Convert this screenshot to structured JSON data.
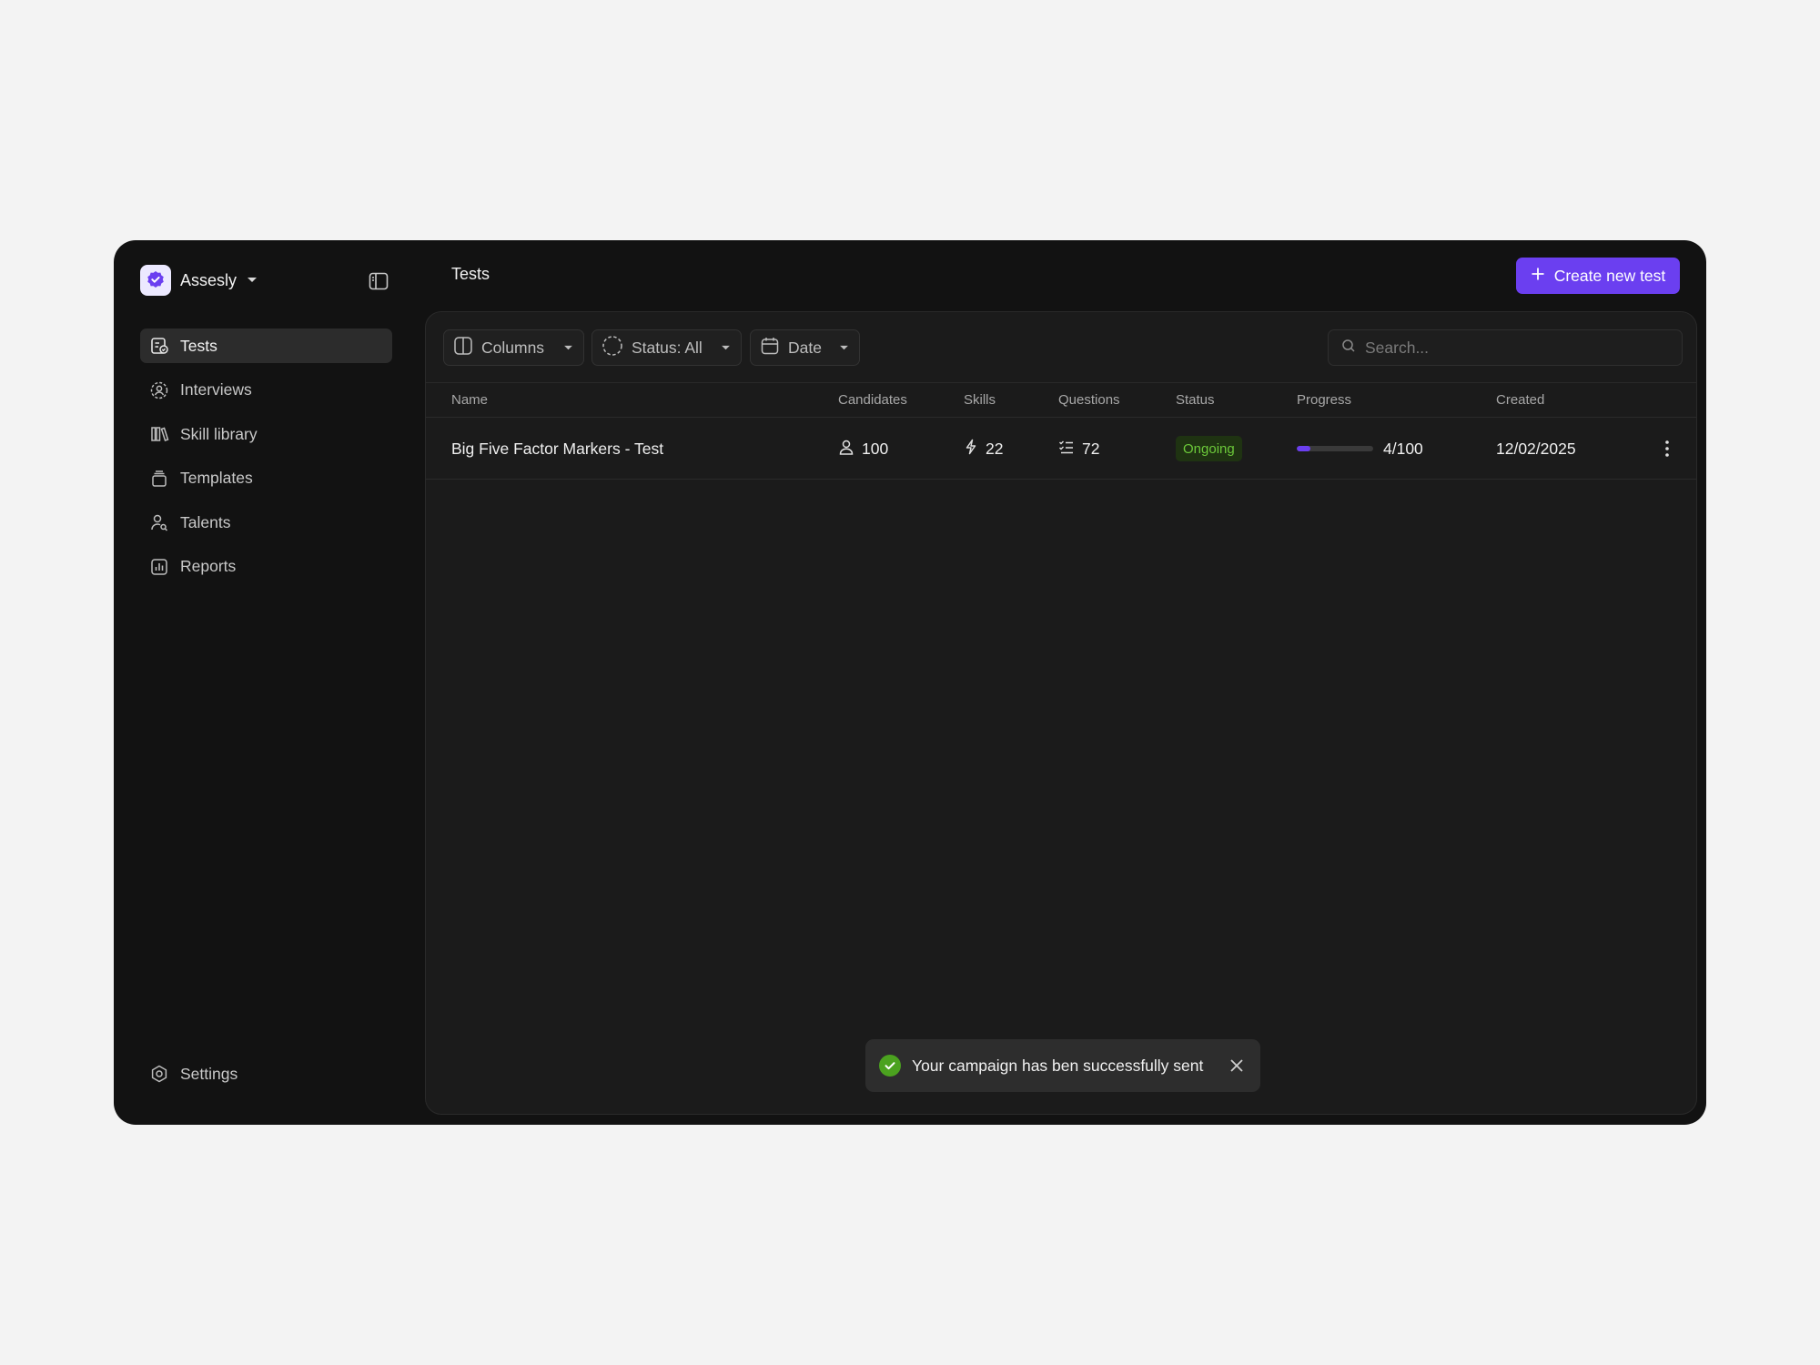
{
  "app": {
    "brand_name": "Assesly",
    "brand_icon": "verified-badge-icon",
    "accent_color": "#6b3ff0"
  },
  "sidebar": {
    "items": [
      {
        "label": "Tests",
        "icon": "test-clipboard-icon",
        "active": true
      },
      {
        "label": "Interviews",
        "icon": "interview-user-icon",
        "active": false
      },
      {
        "label": "Skill library",
        "icon": "library-icon",
        "active": false
      },
      {
        "label": "Templates",
        "icon": "templates-icon",
        "active": false
      },
      {
        "label": "Talents",
        "icon": "talent-search-icon",
        "active": false
      },
      {
        "label": "Reports",
        "icon": "reports-chart-icon",
        "active": false
      }
    ],
    "settings_label": "Settings"
  },
  "header": {
    "title": "Tests",
    "create_label": "Create new test"
  },
  "toolbar": {
    "columns_label": "Columns",
    "status_label": "Status: All",
    "date_label": "Date",
    "search_placeholder": "Search..."
  },
  "table": {
    "headers": [
      "Name",
      "Candidates",
      "Skills",
      "Questions",
      "Status",
      "Progress",
      "Created"
    ],
    "rows": [
      {
        "name": "Big Five Factor Markers - Test",
        "candidates": "100",
        "skills": "22",
        "questions": "72",
        "status": "Ongoing",
        "status_color": "#6cc93a",
        "progress_text": "4/100",
        "progress_value": 0.04,
        "created": "12/02/2025"
      }
    ]
  },
  "toast": {
    "message": "Your campaign has ben successfully sent",
    "status_color": "#4ba21f"
  }
}
